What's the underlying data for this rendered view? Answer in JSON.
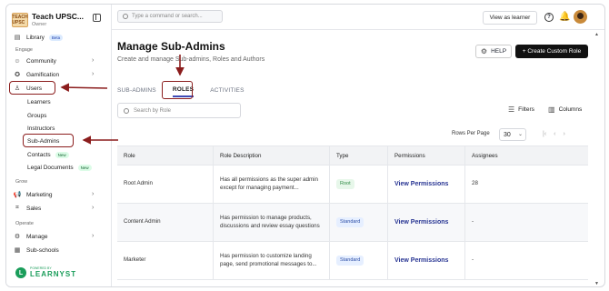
{
  "brand": {
    "name": "Teach UPSC...",
    "role": "Owner",
    "logo_text": "TEACH UPSC"
  },
  "sidebar": {
    "library": "Library",
    "library_badge": "Beta",
    "engage_label": "Engage",
    "community": "Community",
    "gamification": "Gamification",
    "users": "Users",
    "learners": "Learners",
    "groups": "Groups",
    "instructors": "Instructors",
    "sub_admins": "Sub-Admins",
    "contacts": "Contacts",
    "contacts_badge": "New",
    "legal_docs": "Legal Documents",
    "legal_badge": "New",
    "grow_label": "Grow",
    "marketing": "Marketing",
    "sales": "Sales",
    "operate_label": "Operate",
    "manage": "Manage",
    "sub_schools": "Sub-schools",
    "footer_small": "POWERED BY",
    "footer_big": "LEARNYST"
  },
  "topbar": {
    "search_placeholder": "Type a command or search...",
    "view_as_learner": "View as learner",
    "help_symbol": "?",
    "bell_symbol": "🔔"
  },
  "page": {
    "title": "Manage Sub-Admins",
    "subtitle": "Create and manage Sub-admins, Roles and Authors",
    "help_btn": "HELP",
    "create_btn": "+ Create Custom Role",
    "tabs": [
      "SUB-ADMINS",
      "ROLES",
      "ACTIVITIES"
    ],
    "active_tab": "ROLES",
    "search_placeholder": "Search by Role",
    "filters": "Filters",
    "columns": "Columns",
    "rows_per_page_label": "Rows Per Page",
    "rows_per_page": "30"
  },
  "table": {
    "headers": [
      "Role",
      "Role Description",
      "Type",
      "Permissions",
      "Assignees"
    ],
    "rows": [
      {
        "role": "Root Admin",
        "desc": "Has all permissions as the super admin except for managing payment...",
        "type": "Root",
        "perm": "View Permissions",
        "assignees": "28"
      },
      {
        "role": "Content Admin",
        "desc": "Has permission to manage products, discussions and review essay questions",
        "type": "Standard",
        "perm": "View Permissions",
        "assignees": "-"
      },
      {
        "role": "Marketer",
        "desc": "Has permission to customize landing page, send promotional messages to...",
        "type": "Standard",
        "perm": "View Permissions",
        "assignees": "-"
      }
    ]
  },
  "colors": {
    "accent": "#3f4bb5",
    "annotation": "#8b1d1d",
    "brand_green": "#1a9d5a",
    "primary_button": "#111111"
  }
}
